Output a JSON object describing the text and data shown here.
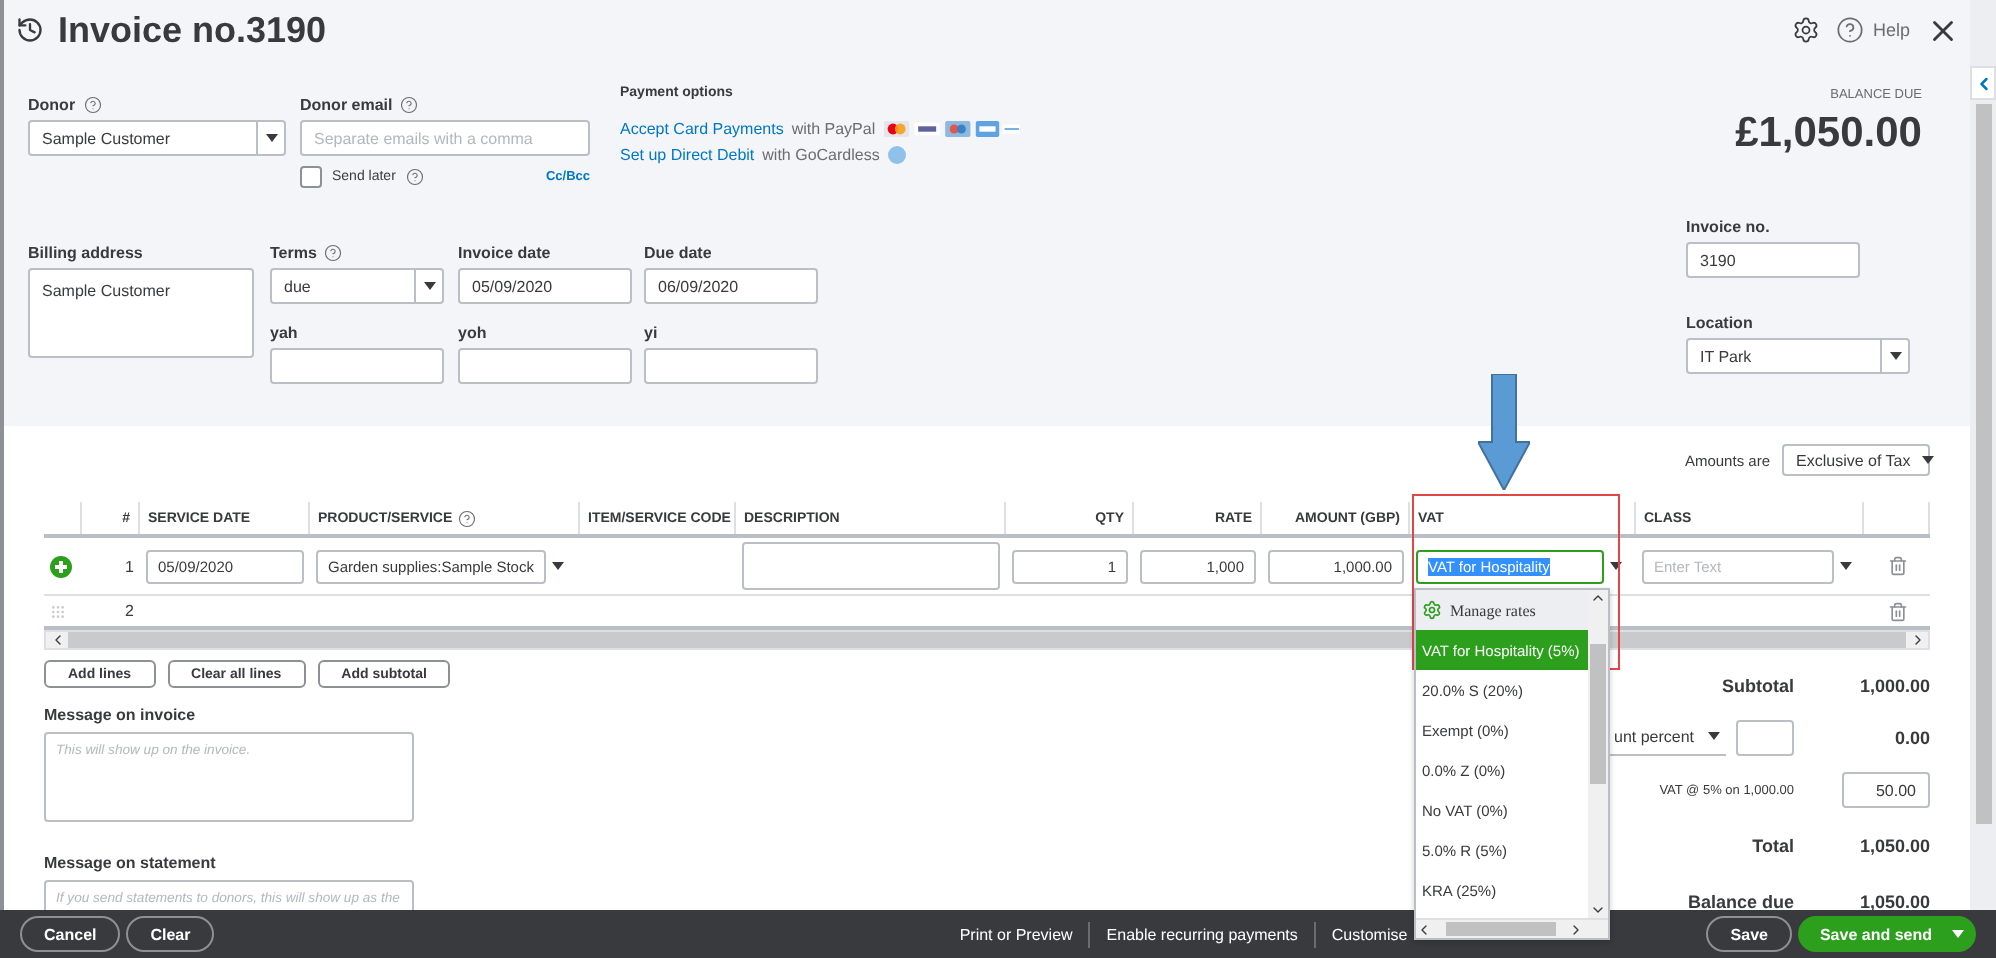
{
  "header": {
    "title": "Invoice no.3190",
    "help": "Help"
  },
  "donor": {
    "label": "Donor",
    "value": "Sample Customer"
  },
  "donor_email": {
    "label": "Donor email",
    "placeholder": "Separate emails with a comma",
    "cc_bcc": "Cc/Bcc"
  },
  "send_later": {
    "label": "Send later",
    "checked": false
  },
  "payment_options": {
    "title": "Payment options",
    "card_link": "Accept Card Payments",
    "card_suffix": "with PayPal",
    "debit_link": "Set up Direct Debit",
    "debit_suffix": "with GoCardless"
  },
  "balance": {
    "label": "BALANCE DUE",
    "amount": "£1,050.00"
  },
  "billing_address": {
    "label": "Billing address",
    "value": "Sample Customer"
  },
  "terms": {
    "label": "Terms",
    "value": "due"
  },
  "invoice_date": {
    "label": "Invoice date",
    "value": "05/09/2020"
  },
  "due_date": {
    "label": "Due date",
    "value": "06/09/2020"
  },
  "custom_fields": [
    {
      "label": "yah"
    },
    {
      "label": "yoh"
    },
    {
      "label": "yi"
    }
  ],
  "invoice_no": {
    "label": "Invoice no.",
    "value": "3190"
  },
  "location": {
    "label": "Location",
    "value": "IT Park"
  },
  "amounts_are": {
    "label": "Amounts are",
    "value": "Exclusive of Tax"
  },
  "table": {
    "columns": [
      "#",
      "SERVICE DATE",
      "PRODUCT/SERVICE",
      "ITEM/SERVICE CODE",
      "DESCRIPTION",
      "QTY",
      "RATE",
      "AMOUNT (GBP)",
      "VAT",
      "CLASS"
    ],
    "rows": [
      {
        "number": "1",
        "editing": true,
        "service_date": "05/09/2020",
        "product": "Garden supplies:Sample Stock",
        "qty": "1",
        "rate": "1,000",
        "amount": "1,000.00",
        "vat": "VAT for Hospitality",
        "class_placeholder": "Enter Text"
      },
      {
        "number": "2",
        "editing": false
      }
    ]
  },
  "line_buttons": [
    "Add lines",
    "Clear all lines",
    "Add subtotal"
  ],
  "message_invoice": {
    "label": "Message on invoice",
    "placeholder": "This will show up on the invoice."
  },
  "message_statement": {
    "label": "Message on statement",
    "placeholder": "If you send statements to donors, this will show up as the"
  },
  "totals": {
    "subtotal_label": "Subtotal",
    "subtotal": "1,000.00",
    "discount_type": "unt percent",
    "discount": "0.00",
    "vat_label": "VAT @ 5% on 1,000.00",
    "vat": "50.00",
    "total_label": "Total",
    "total": "1,050.00",
    "balance_label": "Balance due",
    "balance": "1,050.00"
  },
  "vat_menu": {
    "manage": "Manage rates",
    "options": [
      {
        "label": "VAT for Hospitality (5%)",
        "selected": true
      },
      {
        "label": "20.0% S (20%)",
        "selected": false
      },
      {
        "label": "Exempt (0%)",
        "selected": false
      },
      {
        "label": "0.0% Z (0%)",
        "selected": false
      },
      {
        "label": "No VAT (0%)",
        "selected": false
      },
      {
        "label": "5.0% R (5%)",
        "selected": false
      },
      {
        "label": "KRA (25%)",
        "selected": false
      }
    ]
  },
  "footer": {
    "cancel": "Cancel",
    "clear": "Clear",
    "links": [
      "Print or Preview",
      "Enable recurring payments",
      "Customise"
    ],
    "save": "Save",
    "save_send": "Save and send"
  }
}
